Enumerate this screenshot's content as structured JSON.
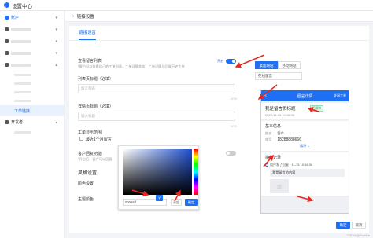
{
  "app": {
    "title": "设置中心"
  },
  "sidebar": {
    "items": [
      {
        "label": "账户"
      },
      {
        "label": ""
      },
      {
        "label": ""
      },
      {
        "label": ""
      },
      {
        "label": ""
      }
    ],
    "active_sub": "工单链接",
    "developer": "开发者"
  },
  "breadcrumb": {
    "title": "链接设置"
  },
  "tabs": {
    "main": "链接设置"
  },
  "form": {
    "show_list_label": "查看留言列表",
    "show_list_hint": "*客户可以查看自己的工单列表，工单详情状态，工单详情与回复历史工单",
    "toggle_on_label": "开启",
    "list_title_label": "列表页标题（必填）",
    "list_title_placeholder": "留言列表",
    "list_title_count": "0/30",
    "detail_title_label": "详情页标题（必填）",
    "detail_title_placeholder": "输入标题",
    "detail_title_count": "0/30",
    "ticket_show_label": "工单显示范围",
    "ticket_show_option": "最近1个月留言",
    "customer_reply_label": "客户回复功能",
    "customer_reply_hint": "*开启后，客户可以回复",
    "style_section": "风格设置",
    "color_label": "颜色设置",
    "theme_color_label": "主题颜色"
  },
  "color_picker": {
    "hex_value": "#0066ff",
    "clear_label": "清空",
    "ok_label": "确定",
    "swatch_glyph": "v"
  },
  "preview": {
    "tab_desktop": "桌面网站",
    "tab_mobile": "移动网站",
    "page_select": "在线留言",
    "header_title": "留言详情",
    "header_right": "关闭工单",
    "back_glyph": "<",
    "ticket_title": "我是留言页标题",
    "status_badge": "已解决",
    "date": "2022-11-15 10:16:36",
    "basic_info": "基本信息",
    "name_label": "姓名",
    "name_value": "客户",
    "phone_label": "电话",
    "phone_value": "18288888666",
    "expand_label": "展示 ⌄",
    "log_section": "操作记录",
    "log_item": "用户发了回复 · 11-15 10:16:36",
    "log_quote": "我是留言的内容",
    "image_glyph": "▨"
  },
  "footer": {
    "save_label": "确定",
    "cancel_label": "取消",
    "watermark": "CSDN @PowDa"
  },
  "colors": {
    "accent": "#1e6ff1",
    "arrow": "#e8281e"
  }
}
